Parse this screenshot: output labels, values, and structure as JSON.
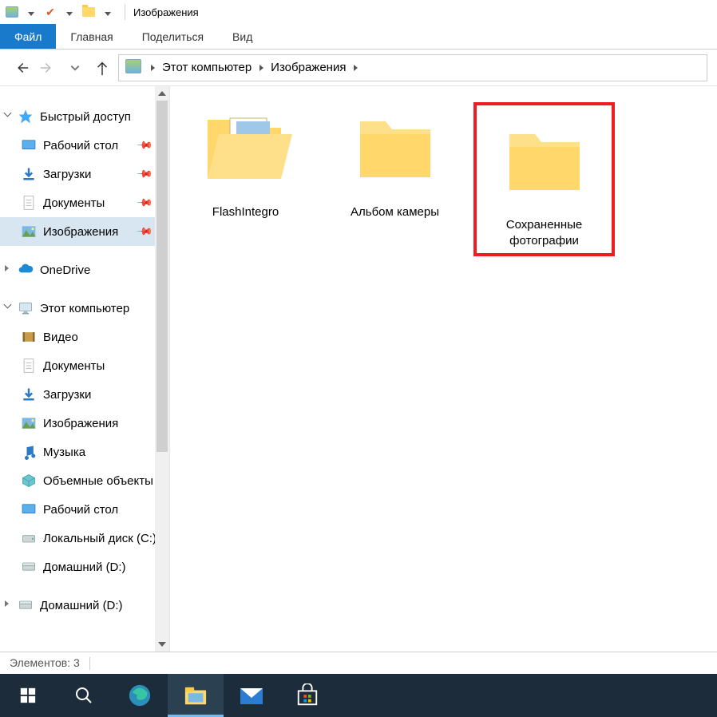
{
  "window": {
    "title": "Изображения"
  },
  "ribbon": {
    "file": "Файл",
    "tabs": [
      "Главная",
      "Поделиться",
      "Вид"
    ]
  },
  "breadcrumb": {
    "segments": [
      "Этот компьютер",
      "Изображения"
    ]
  },
  "sidebar": {
    "groups": [
      {
        "kind": "root",
        "icon": "star",
        "label": "Быстрый доступ",
        "expanded": true
      },
      {
        "kind": "pin",
        "icon": "desktop",
        "label": "Рабочий стол",
        "pinned": true
      },
      {
        "kind": "pin",
        "icon": "download",
        "label": "Загрузки",
        "pinned": true
      },
      {
        "kind": "pin",
        "icon": "document",
        "label": "Документы",
        "pinned": true
      },
      {
        "kind": "pin",
        "icon": "picture",
        "label": "Изображения",
        "pinned": true,
        "selected": true
      },
      {
        "kind": "root",
        "icon": "onedrive",
        "label": "OneDrive",
        "expanded": false,
        "space_before": true
      },
      {
        "kind": "root",
        "icon": "pc",
        "label": "Этот компьютер",
        "expanded": true,
        "space_before": true
      },
      {
        "kind": "sub",
        "icon": "video",
        "label": "Видео"
      },
      {
        "kind": "sub",
        "icon": "document",
        "label": "Документы"
      },
      {
        "kind": "sub",
        "icon": "download",
        "label": "Загрузки"
      },
      {
        "kind": "sub",
        "icon": "picture",
        "label": "Изображения"
      },
      {
        "kind": "sub",
        "icon": "music",
        "label": "Музыка"
      },
      {
        "kind": "sub",
        "icon": "3d",
        "label": "Объемные объекты"
      },
      {
        "kind": "sub",
        "icon": "desktop",
        "label": "Рабочий стол"
      },
      {
        "kind": "sub",
        "icon": "disk",
        "label": "Локальный диск (C:)"
      },
      {
        "kind": "sub",
        "icon": "drive",
        "label": "Домашний (D:)"
      },
      {
        "kind": "root",
        "icon": "drive",
        "label": "Домашний (D:)",
        "expanded": false,
        "space_before": true
      }
    ]
  },
  "content": {
    "items": [
      {
        "type": "folder-open-docs",
        "label": "FlashIntegro",
        "highlighted": false
      },
      {
        "type": "folder",
        "label": "Альбом камеры",
        "highlighted": false
      },
      {
        "type": "folder",
        "label": "Сохраненные фотографии",
        "highlighted": true
      }
    ]
  },
  "status": {
    "label": "Элементов:",
    "count": "3"
  }
}
